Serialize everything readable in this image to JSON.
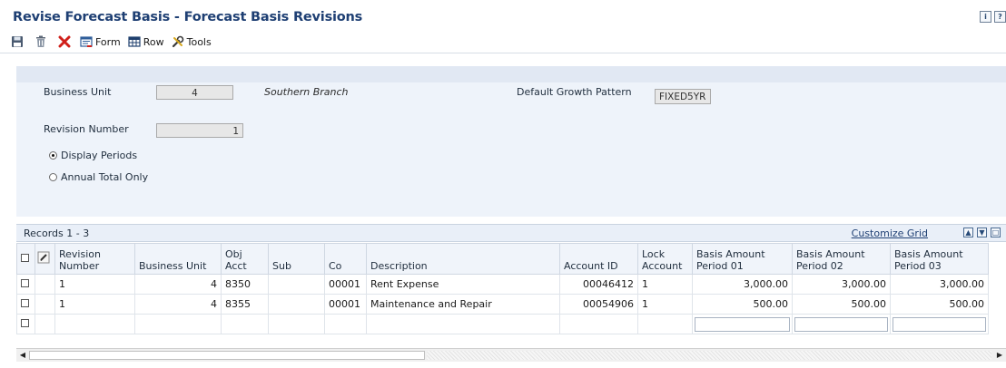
{
  "title": "Revise Forecast Basis - Forecast Basis Revisions",
  "help_icons": [
    "info-icon",
    "help-icon"
  ],
  "toolbar": {
    "save_icon": "save-icon",
    "delete_icon": "trash-icon",
    "cancel_icon": "close-icon",
    "form_label": "Form",
    "row_label": "Row",
    "tools_label": "Tools"
  },
  "header": {
    "business_unit_label": "Business Unit",
    "business_unit_value": "4",
    "business_unit_desc": "Southern Branch",
    "growth_pattern_label": "Default Growth Pattern",
    "growth_pattern_value": "FIXED5YR",
    "revision_number_label": "Revision Number",
    "revision_number_value": "1",
    "radio_display_periods": "Display Periods",
    "radio_annual_total": "Annual Total Only",
    "selected_radio": "Display Periods"
  },
  "grid": {
    "records_label": "Records 1 - 3",
    "customize_label": "Customize Grid",
    "columns": [
      "Revision Number",
      "Business Unit",
      "Obj Acct",
      "Sub",
      "Co",
      "Description",
      "Account ID",
      "Lock Account",
      "Basis Amount Period 01",
      "Basis Amount Period 02",
      "Basis Amount Period 03"
    ],
    "rows": [
      {
        "revision": "1",
        "bu": "4",
        "obj": "8350",
        "sub": "",
        "co": "00001",
        "desc": "Rent Expense",
        "account_id": "00046412",
        "lock": "1",
        "p01": "3,000.00",
        "p02": "3,000.00",
        "p03": "3,000.00"
      },
      {
        "revision": "1",
        "bu": "4",
        "obj": "8355",
        "sub": "",
        "co": "00001",
        "desc": "Maintenance and Repair",
        "account_id": "00054906",
        "lock": "1",
        "p01": "500.00",
        "p02": "500.00",
        "p03": "500.00"
      }
    ]
  },
  "colors": {
    "title": "#1e3f73",
    "header_panel": "#eef3fa",
    "grid_header": "#f0f4fa"
  }
}
